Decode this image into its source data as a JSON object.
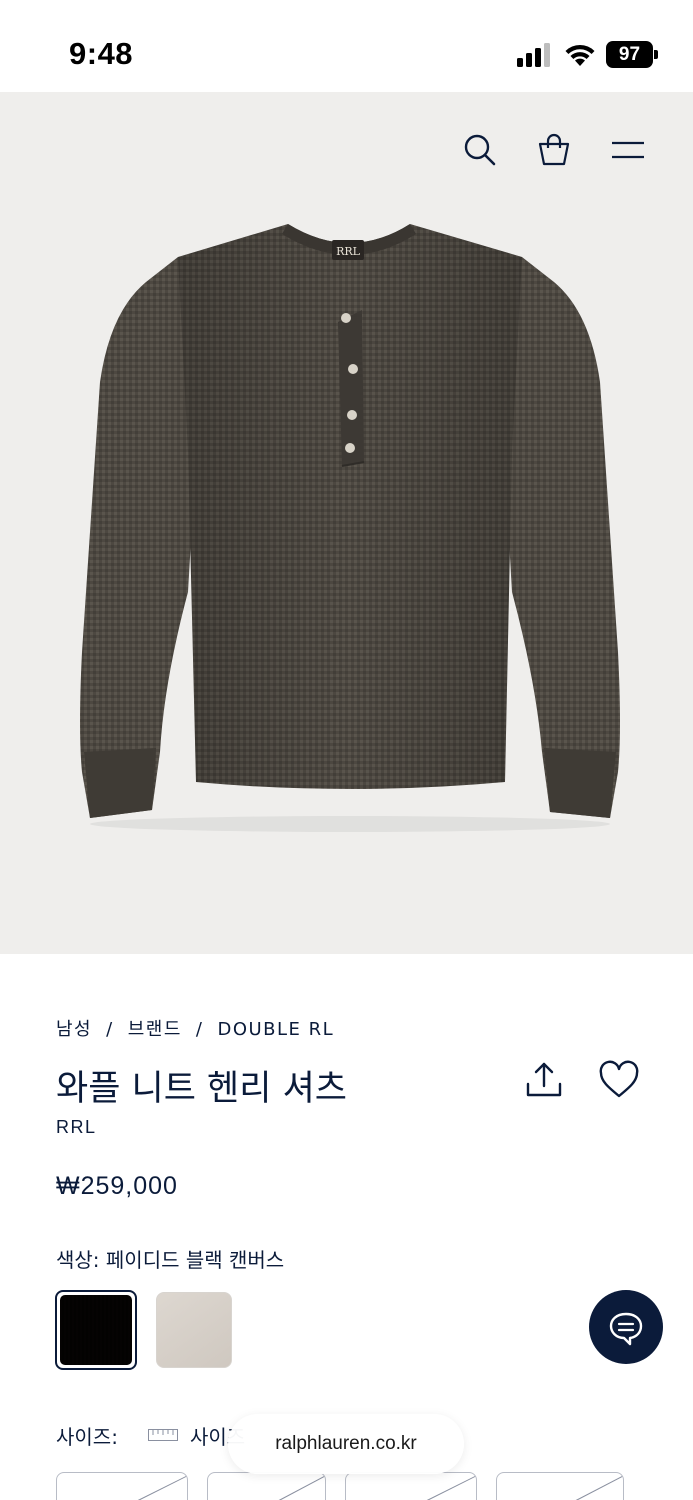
{
  "status_bar": {
    "time": "9:48",
    "battery": "97"
  },
  "breadcrumb": {
    "items": [
      "남성",
      "브랜드",
      "DOUBLE RL"
    ],
    "separator": "/"
  },
  "product": {
    "title": "와플 니트 헨리 셔츠",
    "brand": "RRL",
    "price": "₩259,000",
    "color_label": "색상: 페이디드 블랙 캔버스",
    "colors": [
      {
        "name": "페이디드 블랙 캔버스",
        "hex": "#1c1714",
        "selected": true
      },
      {
        "name": "",
        "hex": "#d6d0c8",
        "selected": false
      }
    ],
    "size_label": "사이즈:",
    "size_guide_label": "사이즈"
  },
  "browser": {
    "url": "ralphlauren.co.kr"
  },
  "icons": {
    "search": "search-icon",
    "bag": "shopping-bag-icon",
    "menu": "hamburger-menu-icon",
    "share": "share-icon",
    "wishlist": "heart-icon",
    "chat": "chat-bubble-icon",
    "ruler": "ruler-icon"
  },
  "colors": {
    "navy": "#0b1b3a",
    "hero_bg": "#efeeec"
  }
}
